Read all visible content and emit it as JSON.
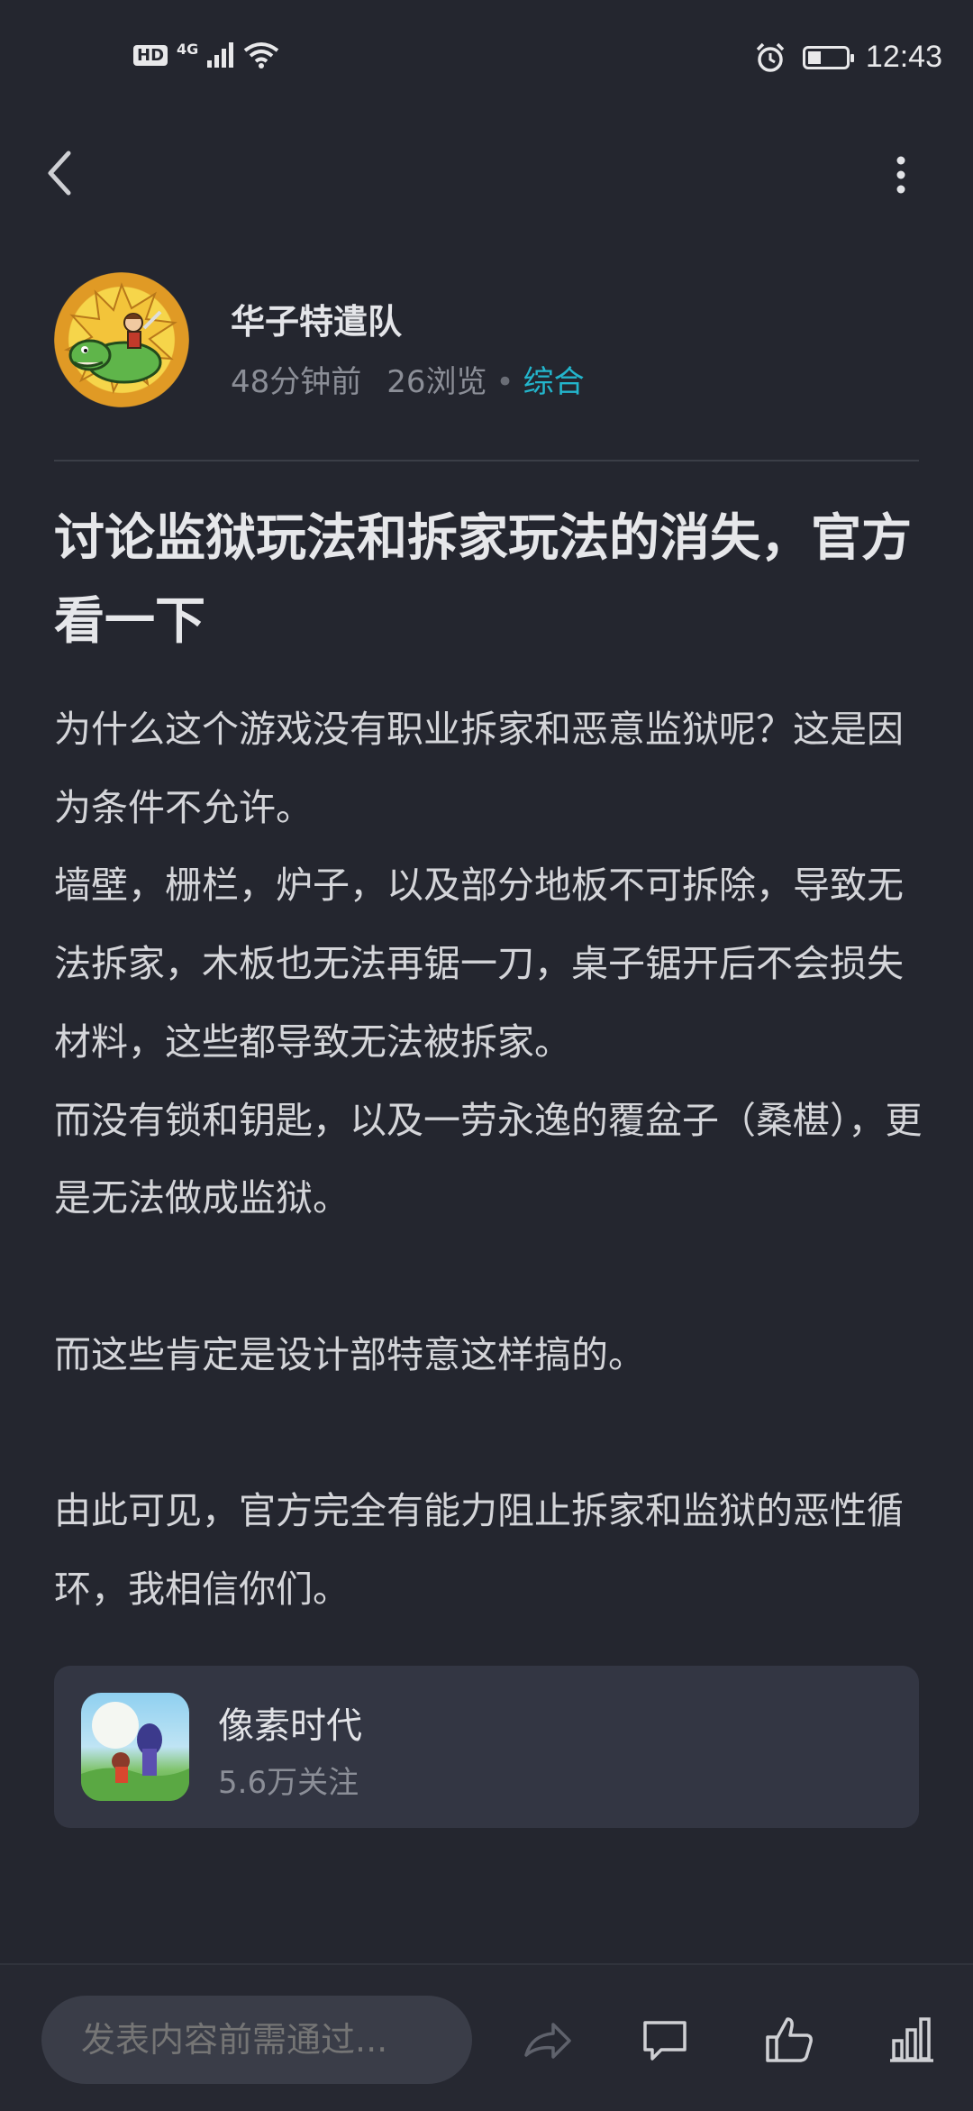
{
  "status_bar": {
    "network": "4G",
    "hd_badge": "HD",
    "time": "12:43",
    "battery_level": 0.35
  },
  "nav": {
    "back_icon": "chevron-left-icon",
    "more_icon": "more-vertical-icon"
  },
  "author": {
    "name": "华子特遣队",
    "posted": "48分钟前",
    "views": "26浏览",
    "category": "综合"
  },
  "post": {
    "title": "讨论监狱玩法和拆家玩法的消失，官方看一下",
    "paragraphs": [
      "为什么这个游戏没有职业拆家和恶意监狱呢？这是因为条件不允许。",
      "墙壁，栅栏，炉子，以及部分地板不可拆除，导致无法拆家，木板也无法再锯一刀，桌子锯开后不会损失材料，这些都导致无法被拆家。",
      "而没有锁和钥匙，以及一劳永逸的覆盆子（桑椹），更是无法做成监狱。",
      "而这些肯定是设计部特意这样搞的。",
      "由此可见，官方完全有能力阻止拆家和监狱的恶性循环，我相信你们。"
    ]
  },
  "game_card": {
    "name": "像素时代",
    "followers": "5.6万关注"
  },
  "bottom_bar": {
    "input_placeholder": "发表内容前需通过...",
    "icons": [
      "share-icon",
      "comment-icon",
      "like-icon",
      "rank-icon"
    ]
  },
  "colors": {
    "background": "#24262f",
    "accent": "#23b5cc",
    "card": "#333643"
  }
}
